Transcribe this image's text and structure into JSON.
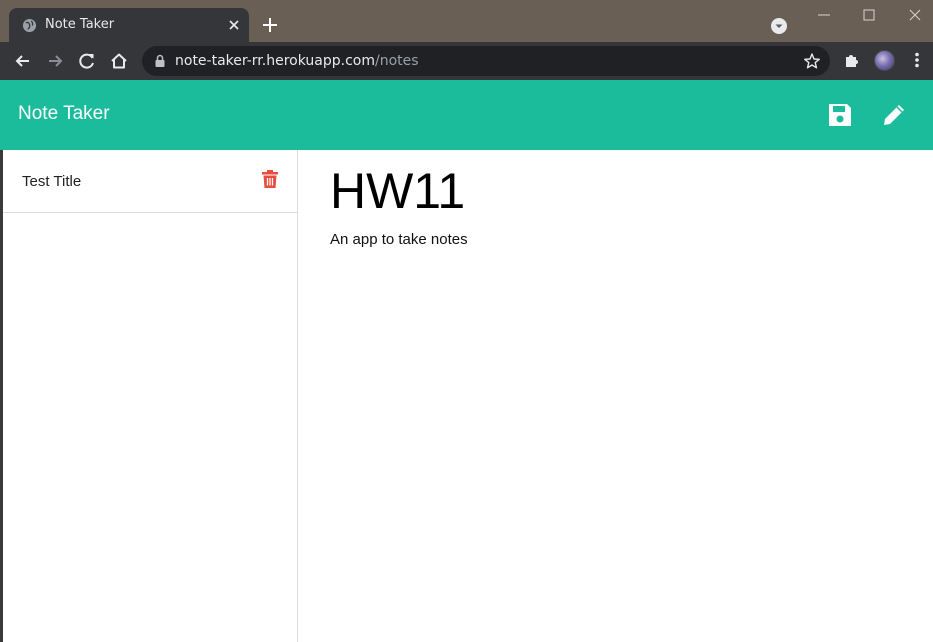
{
  "browser": {
    "tab": {
      "title": "Note Taker"
    },
    "url": {
      "host": "note-taker-rr.herokuapp.com",
      "path": "/notes"
    },
    "colors": {
      "titlebar": "#6a5f55",
      "toolbar": "#35363a",
      "omnibox": "#202124"
    },
    "icons": [
      "globe-icon",
      "close-icon",
      "plus-icon",
      "tab-search-icon",
      "minimize-icon",
      "maximize-icon",
      "window-close-icon",
      "back-arrow-icon",
      "forward-arrow-icon",
      "reload-icon",
      "home-icon",
      "lock-icon",
      "star-icon",
      "puzzle-icon",
      "kebab-menu-icon"
    ]
  },
  "app": {
    "brand": "Note Taker",
    "accent_color": "#1abc9c",
    "header_icons": [
      "save-icon",
      "pencil-icon"
    ],
    "notes": [
      {
        "title": "Test Title",
        "action_icon": "trash-icon",
        "action_color": "#e74c3c"
      }
    ],
    "active_note": {
      "title": "HW11",
      "text": "An app to take notes"
    }
  }
}
